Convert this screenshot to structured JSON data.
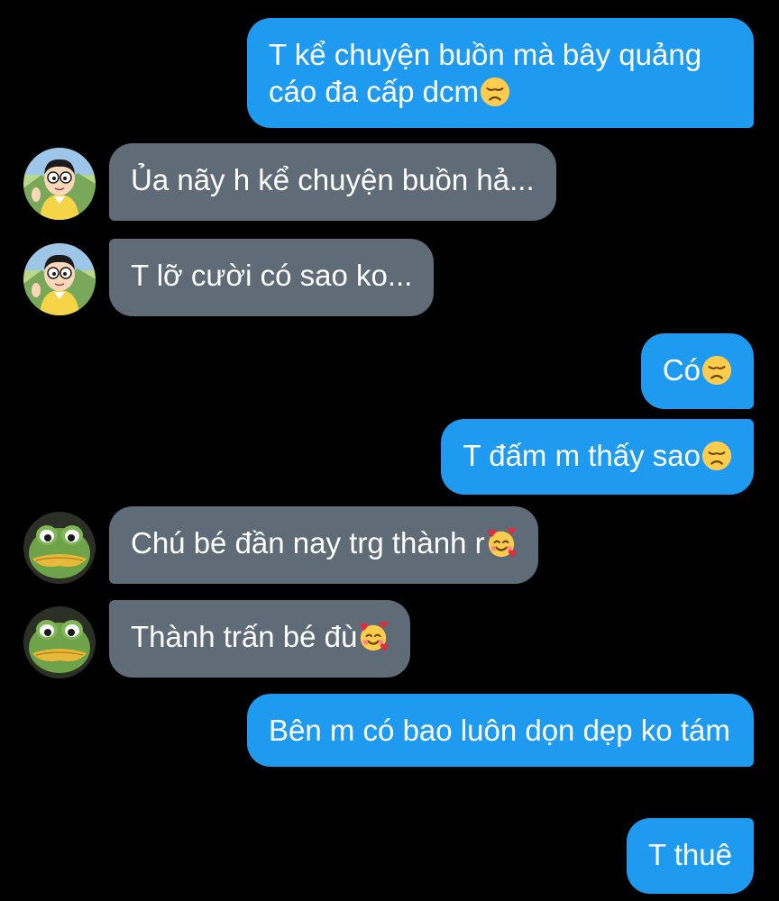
{
  "messages": [
    {
      "side": "out",
      "text": "T kể chuyện buồn mà bây quảng cáo đa cấp dcm",
      "emoji": "disappointed-face"
    },
    {
      "side": "in",
      "sender_avatar": "nobita-avatar",
      "text": "Ủa nãy h kể chuyện buồn hả..."
    },
    {
      "side": "in",
      "sender_avatar": "nobita-avatar",
      "text": "T lỡ cười có sao ko..."
    },
    {
      "side": "out",
      "text": "Có",
      "emoji": "disappointed-face"
    },
    {
      "side": "out",
      "text": "T đấm m thấy sao",
      "emoji": "disappointed-face"
    },
    {
      "side": "in",
      "sender_avatar": "frog-avatar",
      "text": "Chú bé đần nay trg thành r",
      "emoji": "smiling-face-with-hearts"
    },
    {
      "side": "in",
      "sender_avatar": "frog-avatar",
      "text": "Thành trấn bé đù",
      "emoji": "smiling-face-with-hearts"
    },
    {
      "side": "out",
      "text": "Bên m có bao luôn dọn dẹp ko tám"
    },
    {
      "side": "out",
      "text": "T thuê"
    }
  ],
  "colors": {
    "background": "#000000",
    "outgoing_bubble": "#1e9bf0",
    "incoming_bubble": "#5f6b77",
    "text": "#ffffff"
  }
}
